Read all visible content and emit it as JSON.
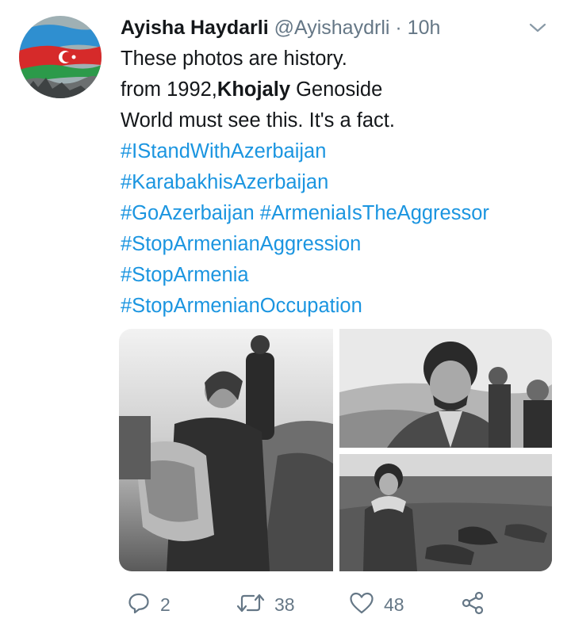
{
  "tweet": {
    "author_name": "Ayisha Haydarli",
    "handle": "@Ayishaydrli",
    "separator": "·",
    "time": "10h",
    "lines": [
      {
        "a": "These photos are history.",
        "b": "",
        "c": ""
      },
      {
        "a": "from 1992,",
        "b": "Khojaly",
        "c": " Genoside"
      },
      {
        "a": "World must see this. It's a fact.",
        "b": "",
        "c": ""
      }
    ],
    "hashtag_lines": [
      "#IStandWithAzerbaijan",
      "#KarabakhisAzerbaijan",
      "#GoAzerbaijan #ArmeniaIsTheAggressor",
      "#StopArmenianAggression",
      "#StopArmenia",
      "#StopArmenianOccupation"
    ]
  },
  "actions": {
    "reply_count": "2",
    "retweet_count": "38",
    "like_count": "48"
  },
  "icons": {
    "reply": "reply-icon",
    "retweet": "retweet-icon",
    "like": "heart-icon",
    "share": "share-icon",
    "menu": "chevron-down-icon"
  },
  "colors": {
    "link": "#1b95e0",
    "muted": "#657786",
    "text": "#14171a"
  }
}
